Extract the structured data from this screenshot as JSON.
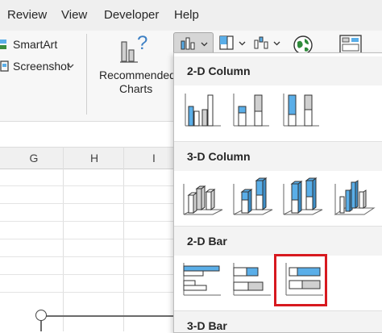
{
  "ribbon_tabs": [
    "Review",
    "View",
    "Developer",
    "Help"
  ],
  "ribbon": {
    "smartart_label": "SmartArt",
    "screenshot_label": "Screenshot",
    "recommended_charts_line1": "Recommended",
    "recommended_charts_line2": "Charts",
    "question_mark": "?"
  },
  "columns": [
    "G",
    "H",
    "I"
  ],
  "chart_menu": {
    "sections": [
      {
        "title": "2-D Column",
        "options": [
          "Clustered Column",
          "Stacked Column",
          "100% Stacked Column"
        ]
      },
      {
        "title": "3-D Column",
        "options": [
          "3-D Clustered Column",
          "3-D Stacked Column",
          "3-D 100% Stacked Column",
          "3-D Column"
        ]
      },
      {
        "title": "2-D Bar",
        "options": [
          "Clustered Bar",
          "Stacked Bar",
          "100% Stacked Bar"
        ],
        "selected_index": 2
      },
      {
        "title": "3-D Bar",
        "options": []
      }
    ]
  },
  "colors": {
    "accent_blue": "#5aaee8",
    "gray_fill": "#d0d0d0",
    "selection_red": "#d7191f",
    "ribbon_bg": "#f7f7f7"
  }
}
